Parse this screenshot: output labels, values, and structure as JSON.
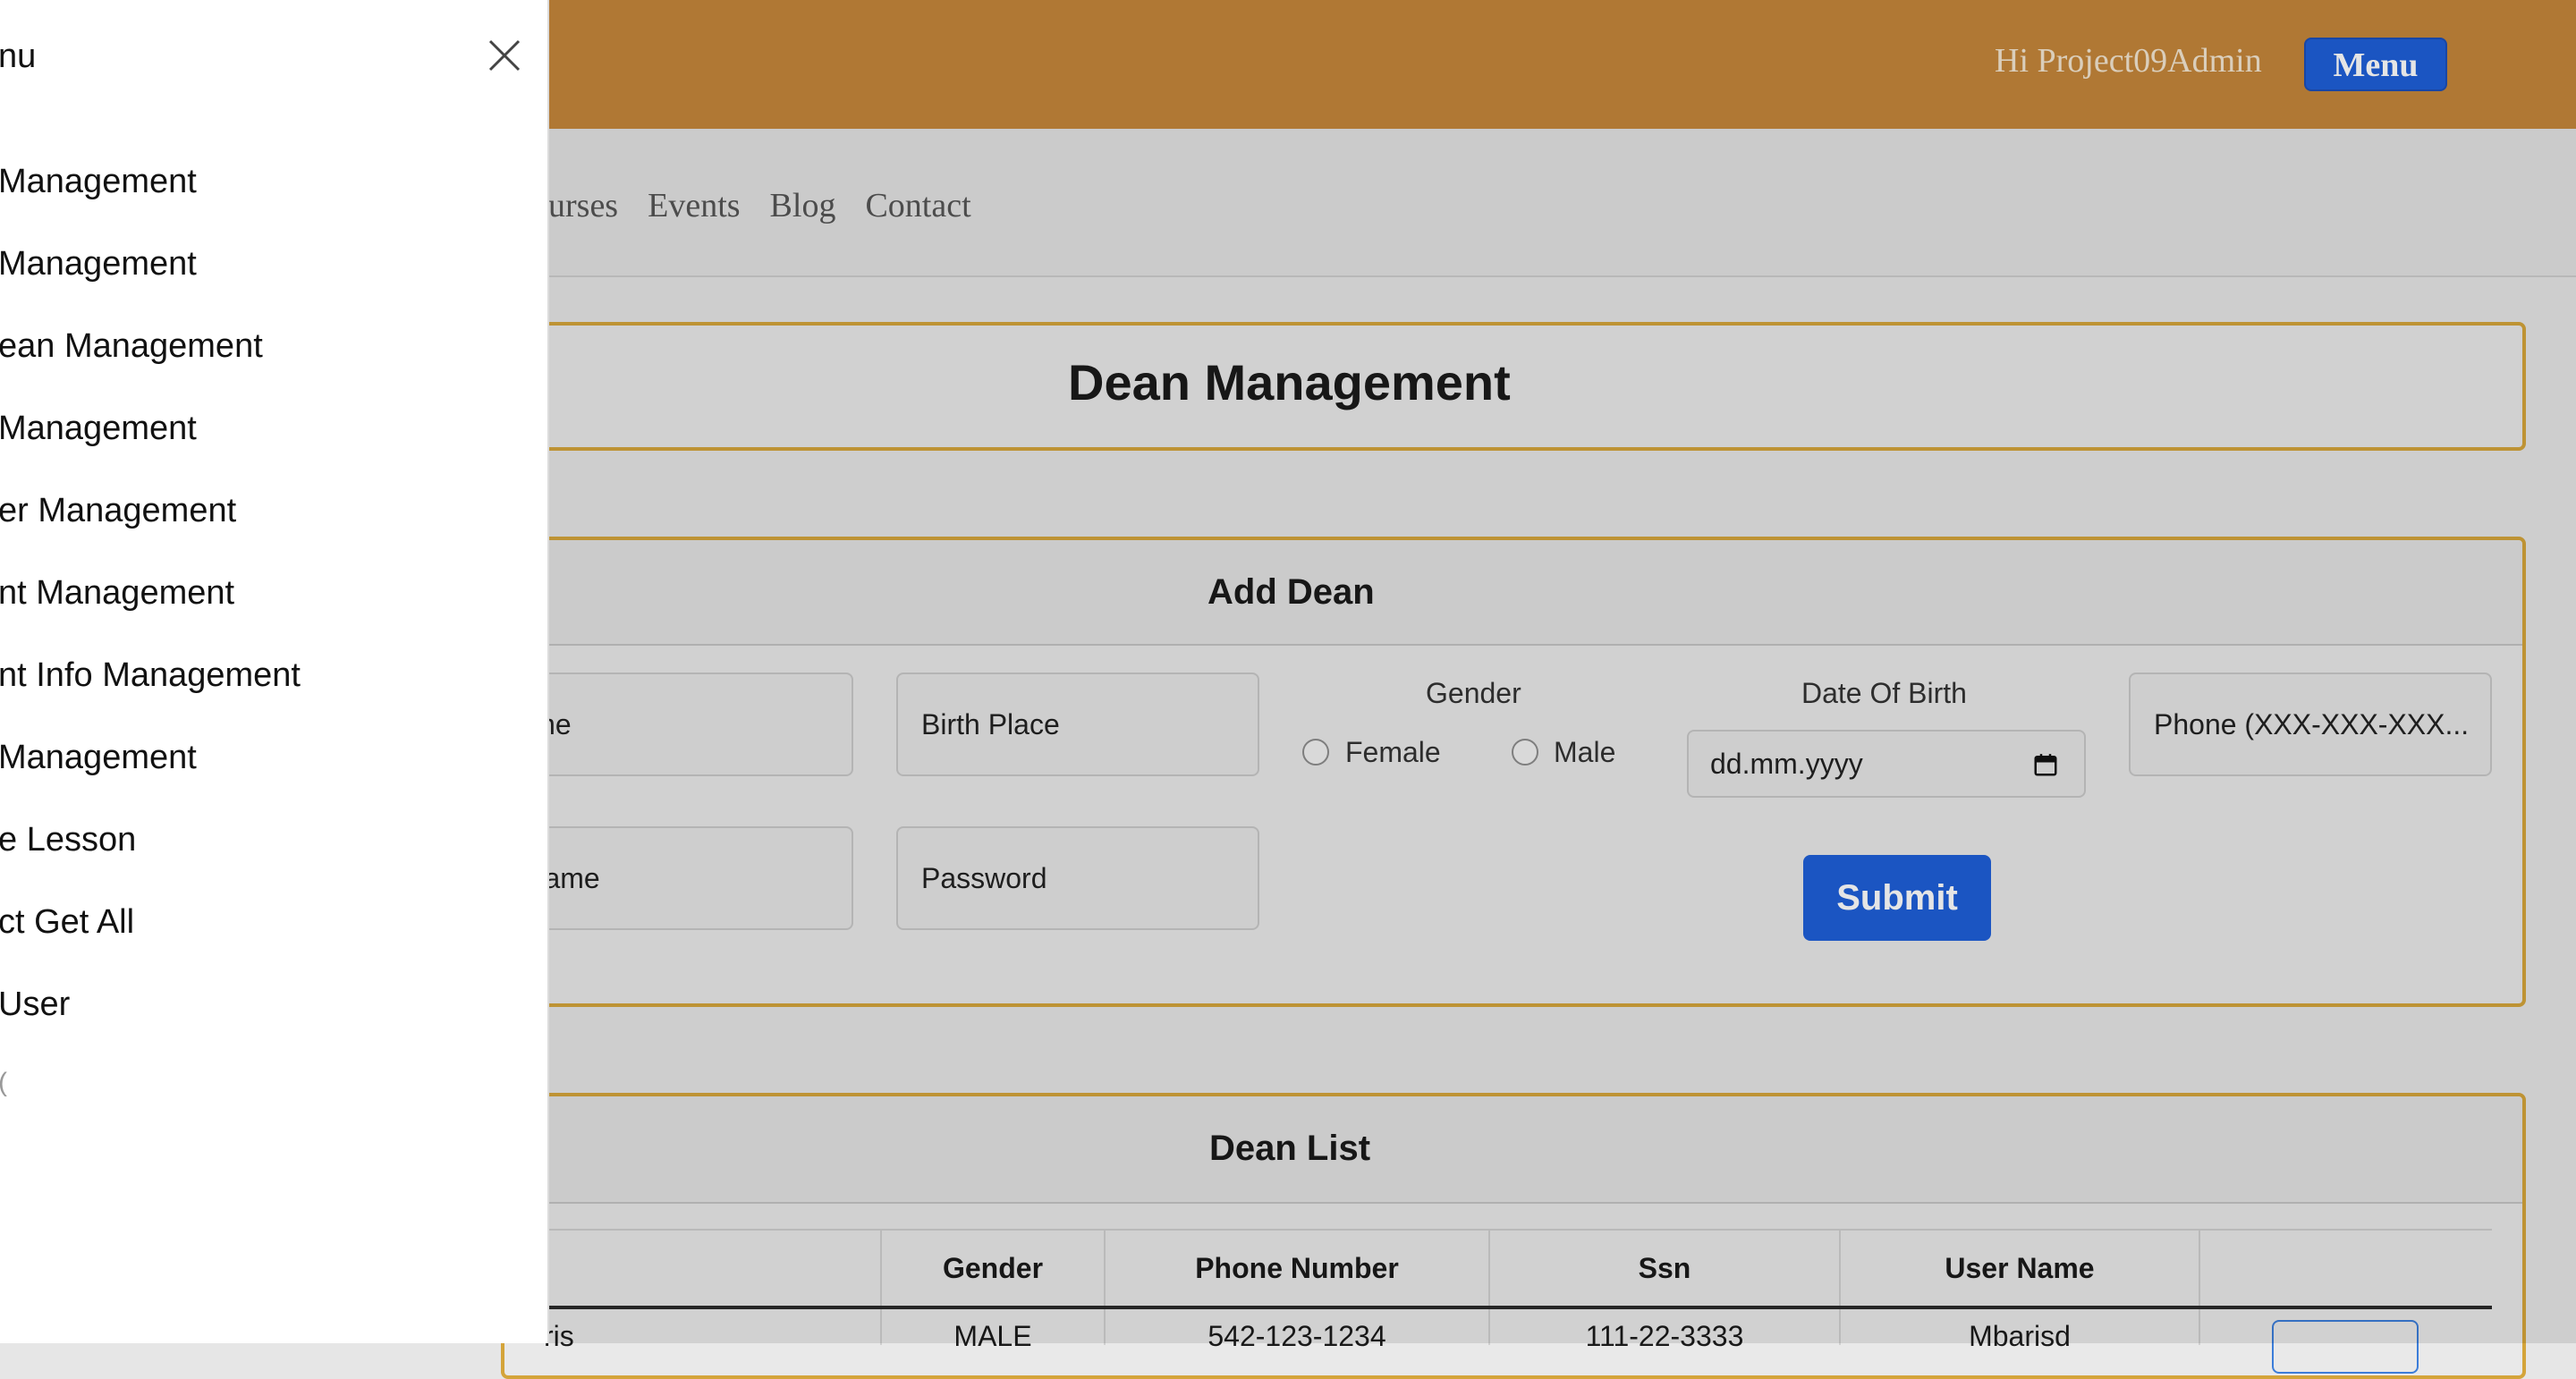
{
  "header": {
    "greeting": "Hi Project09Admin",
    "menu_label": "Menu"
  },
  "nav": {
    "links": [
      "ourses",
      "Events",
      "Blog",
      "Contact"
    ]
  },
  "page": {
    "title": "Dean Management"
  },
  "add_dean": {
    "title": "Add Dean",
    "surname_placeholder": "rname",
    "birth_place_placeholder": "Birth Place",
    "gender_label": "Gender",
    "female_label": "Female",
    "male_label": "Male",
    "dob_label": "Date Of Birth",
    "dob_placeholder": "dd.mm.yyyy",
    "phone_placeholder": "Phone (XXX-XXX-XXX...",
    "username_placeholder": "er Name",
    "password_placeholder": "Password",
    "submit_label": "Submit"
  },
  "dean_list": {
    "title": "Dean List",
    "columns": [
      "Gender",
      "Phone Number",
      "Ssn",
      "User Name"
    ],
    "rows": [
      {
        "name": "ris",
        "gender": "MALE",
        "phone": "542-123-1234",
        "ssn": "111-22-3333",
        "username": "Mbarisd"
      }
    ]
  },
  "offcanvas": {
    "title": "nu",
    "items": [
      "Management",
      "Management",
      "ean Management",
      "Management",
      "er Management",
      "nt Management",
      "nt Info Management",
      "Management",
      "e Lesson",
      "ct Get All",
      "User"
    ],
    "trailing": "("
  },
  "colors": {
    "topbar": "#c4863a",
    "primary": "#1f5fd8",
    "card_border": "#d4a43a"
  }
}
